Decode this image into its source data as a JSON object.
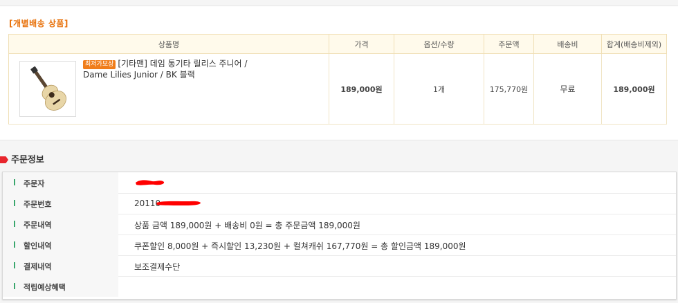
{
  "section_title": "[개별배송 상품]",
  "table": {
    "headers": [
      "상품명",
      "가격",
      "옵션/수량",
      "주문액",
      "배송비",
      "합계(배송비제외)"
    ],
    "row": {
      "badge": "최저가보상",
      "product_name": "[기타맨] 데임 통기타 릴리스 주니어 / Dame Lilies Junior / BK 블랙",
      "price": "189,000원",
      "quantity": "1개",
      "order_amount": "175,770원",
      "shipping": "무료",
      "total": "189,000원"
    }
  },
  "order_info": {
    "heading": "주문정보",
    "rows": [
      {
        "label": "주문자",
        "value": ""
      },
      {
        "label": "주문번호",
        "value": "20110"
      },
      {
        "label": "주문내역",
        "value": "상품 금액 189,000원 + 배송비 0원 = 총 주문금액 189,000원"
      },
      {
        "label": "할인내역",
        "value": "쿠폰할인 8,000원 + 즉시할인 13,230원 + 컬쳐캐쉬 167,770원 = 총 할인금액 189,000원"
      },
      {
        "label": "결제내역",
        "value": "보조결제수단"
      },
      {
        "label": "적립예상혜택",
        "value": ""
      }
    ]
  },
  "colors": {
    "accent": "#e8720c",
    "marker": "#e8262d",
    "redaction": "#ff0000",
    "row_bar": "#3aa76d"
  }
}
